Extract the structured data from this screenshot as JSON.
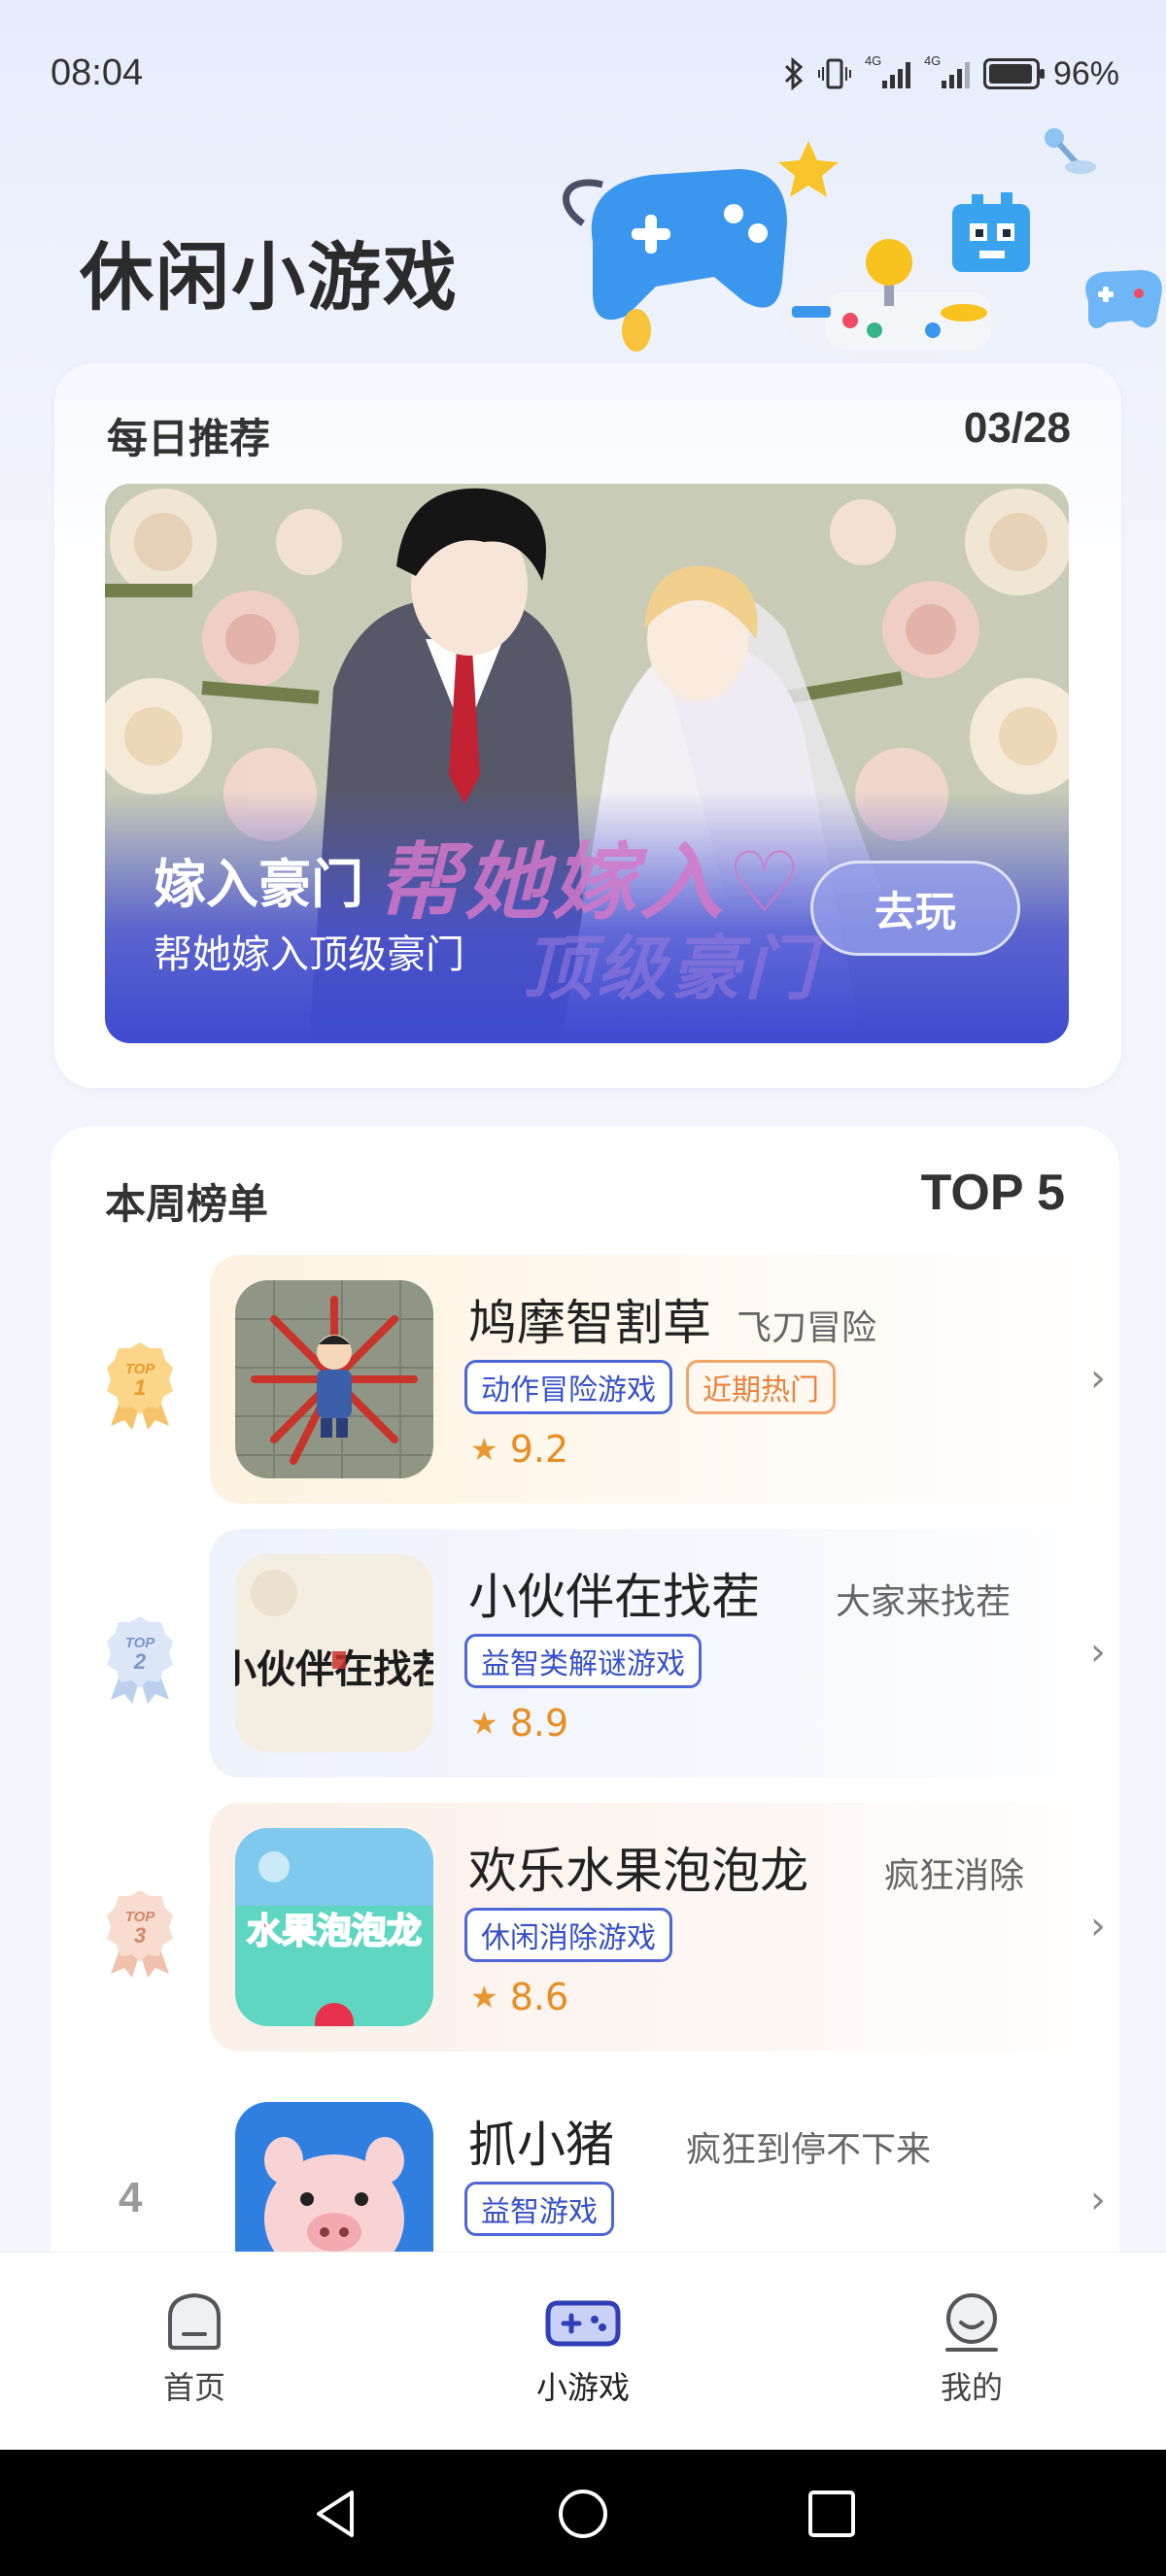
{
  "status_bar": {
    "time": "08:04",
    "battery_percent": "96%",
    "network_label_1": "4G",
    "network_label_2": "4G",
    "icons": [
      "bluetooth-icon",
      "vibrate-icon",
      "signal-icon",
      "signal-icon",
      "battery-icon"
    ]
  },
  "header": {
    "title": "休闲小游戏"
  },
  "daily": {
    "label": "每日推荐",
    "date": "03/28",
    "banner": {
      "title": "嫁入豪门",
      "subtitle": "帮她嫁入顶级豪门",
      "art_text_1": "帮她嫁入♡",
      "art_text_2": "顶级豪门",
      "play_label": "去玩"
    }
  },
  "weekly": {
    "label": "本周榜单",
    "top_label": "TOP 5",
    "items": [
      {
        "rank": "1",
        "badge_text": "TOP",
        "name": "鸠摩智割草",
        "subtitle": "飞刀冒险",
        "tags": [
          "动作冒险游戏",
          "近期热门"
        ],
        "rating": "9.2"
      },
      {
        "rank": "2",
        "badge_text": "TOP",
        "name": "小伙伴在找茬",
        "subtitle": "大家来找茬",
        "tags": [
          "益智类解谜游戏"
        ],
        "rating": "8.9"
      },
      {
        "rank": "3",
        "badge_text": "TOP",
        "name": "欢乐水果泡泡龙",
        "subtitle": "疯狂消除",
        "tags": [
          "休闲消除游戏"
        ],
        "rating": "8.6"
      },
      {
        "rank": "4",
        "name": "抓小猪",
        "subtitle": "疯狂到停不下来",
        "tags": [
          "益智游戏"
        ]
      }
    ],
    "thumb_text_2": "小伙伴在找茬",
    "thumb_text_3": "水果泡泡龙"
  },
  "bottom_nav": {
    "items": [
      {
        "label": "首页",
        "icon": "home-icon"
      },
      {
        "label": "小游戏",
        "icon": "gamepad-icon",
        "active": true
      },
      {
        "label": "我的",
        "icon": "profile-icon"
      }
    ]
  },
  "system_nav": [
    "back-icon",
    "home-circle-icon",
    "recents-icon"
  ],
  "colors": {
    "accent": "#3e4ad0",
    "tag_blue": "#4f66d6",
    "tag_orange": "#f0a56b",
    "rating": "#e88d22"
  }
}
